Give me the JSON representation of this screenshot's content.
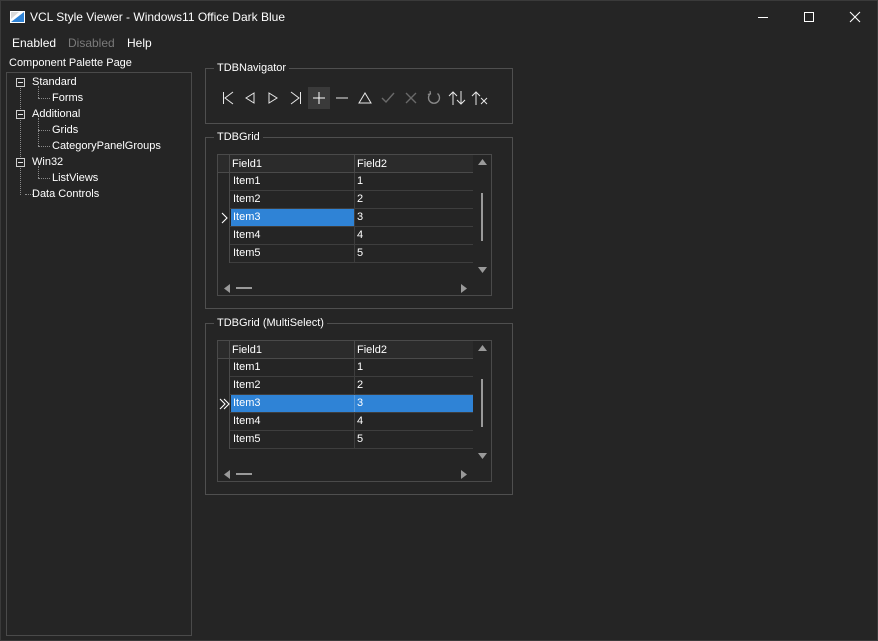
{
  "window": {
    "title": "VCL Style Viewer - Windows11 Office Dark Blue",
    "controls": {
      "minimize": "minimize-icon",
      "maximize": "maximize-icon",
      "close": "close-icon"
    }
  },
  "menu": {
    "items": [
      "Enabled",
      "Disabled",
      "Help"
    ]
  },
  "palette": {
    "label": "Component Palette Page",
    "tree": [
      {
        "label": "Standard",
        "children": [
          "Forms"
        ]
      },
      {
        "label": "Additional",
        "children": [
          "Grids",
          "CategoryPanelGroups"
        ]
      },
      {
        "label": "Win32",
        "children": [
          "ListViews"
        ]
      },
      {
        "label": "Data Controls",
        "children": []
      }
    ]
  },
  "navigator": {
    "caption": "TDBNavigator",
    "buttons": [
      "first-icon",
      "prior-icon",
      "next-icon",
      "last-icon",
      "insert-icon",
      "delete-icon",
      "edit-icon",
      "post-icon",
      "cancel-icon",
      "refresh-icon",
      "apply-updates-icon",
      "cancel-updates-icon"
    ]
  },
  "grid1": {
    "caption": "TDBGrid",
    "columns": [
      "Field1",
      "Field2"
    ],
    "rows": [
      [
        "Item1",
        "1"
      ],
      [
        "Item2",
        "2"
      ],
      [
        "Item3",
        "3"
      ],
      [
        "Item4",
        "4"
      ],
      [
        "Item5",
        "5"
      ]
    ],
    "current_row": 2,
    "indicator": "arrow-indicator-icon"
  },
  "grid2": {
    "caption": "TDBGrid (MultiSelect)",
    "columns": [
      "Field1",
      "Field2"
    ],
    "rows": [
      [
        "Item1",
        "1"
      ],
      [
        "Item2",
        "2"
      ],
      [
        "Item3",
        "3"
      ],
      [
        "Item4",
        "4"
      ],
      [
        "Item5",
        "5"
      ]
    ],
    "current_row": 2,
    "indicator": "double-arrow-indicator-icon"
  },
  "colors": {
    "selection": "#2f83d6",
    "background": "#252525",
    "border": "#4f4f4f",
    "text": "#ffffff",
    "disabled_text": "#7a7a7a"
  }
}
